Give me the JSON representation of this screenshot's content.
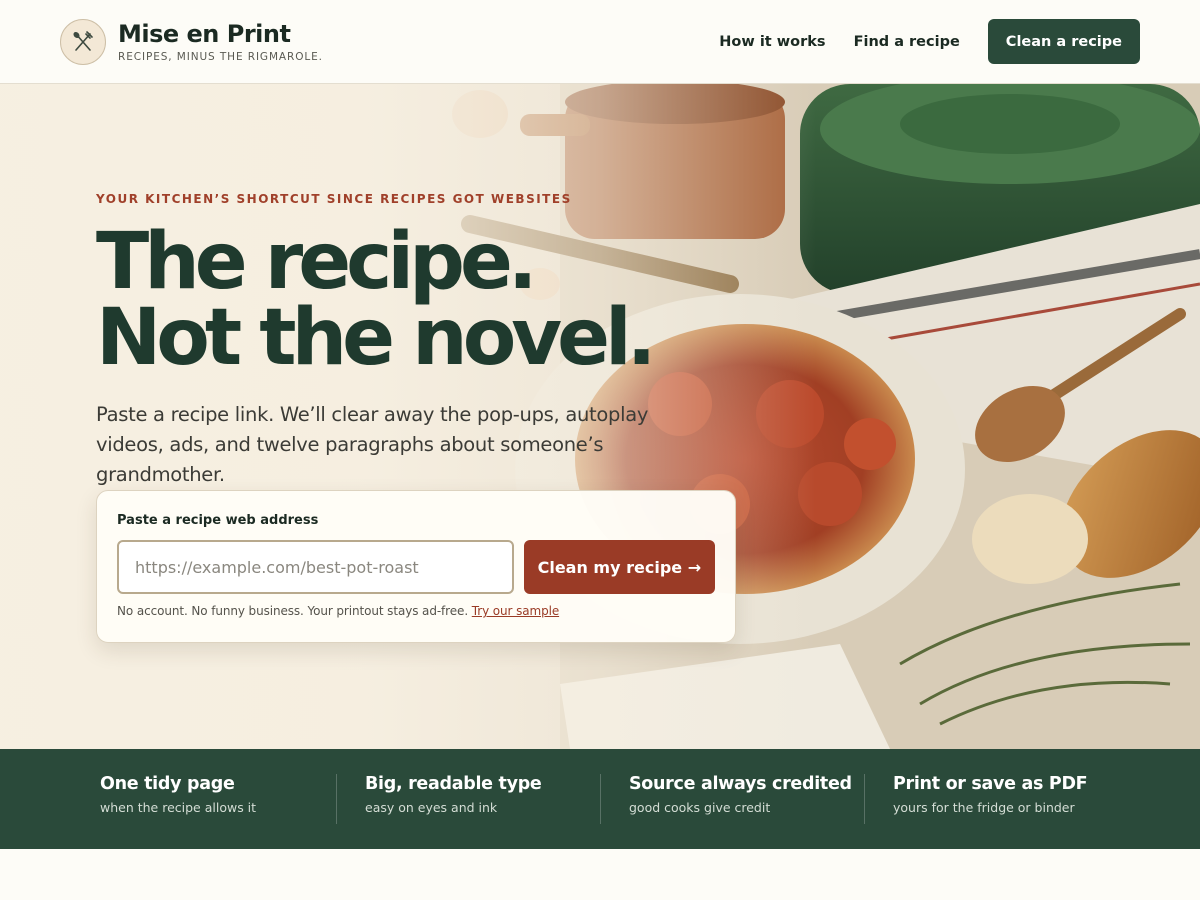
{
  "brand": {
    "name": "Mise en Print",
    "tagline": "RECIPES, MINUS THE RIGMAROLE.",
    "logo_icon": "fork-and-spoon-icon"
  },
  "nav": {
    "how_it_works": "How it works",
    "find_recipe": "Find a recipe",
    "cta": "Clean a recipe"
  },
  "hero": {
    "eyebrow": "YOUR KITCHEN’S SHORTCUT SINCE RECIPES GOT WEBSITES",
    "headline_line1": "The recipe.",
    "headline_line2": "Not the novel.",
    "subtitle": "Paste a recipe link. We’ll clear away the pop-ups, autoplay videos, ads, and twelve paragraphs about someone’s grandmother."
  },
  "form": {
    "label": "Paste a recipe web address",
    "placeholder": "https://example.com/best-pot-roast",
    "value": "",
    "submit_label": "Clean my recipe →",
    "note": "No account. No funny business. Your printout stays ad-free.",
    "sample_link": "Try our sample"
  },
  "features": [
    {
      "title": "One tidy page",
      "subtitle": "when the recipe allows it"
    },
    {
      "title": "Big, readable type",
      "subtitle": "easy on eyes and ink"
    },
    {
      "title": "Source always credited",
      "subtitle": "good cooks give credit"
    },
    {
      "title": "Print or save as PDF",
      "subtitle": "yours for the fridge or binder"
    }
  ],
  "colors": {
    "brand_green": "#2a4a3a",
    "accent_rust": "#9a3b26",
    "headline_green": "#1f3a2e",
    "cream": "#fdfcf7"
  }
}
